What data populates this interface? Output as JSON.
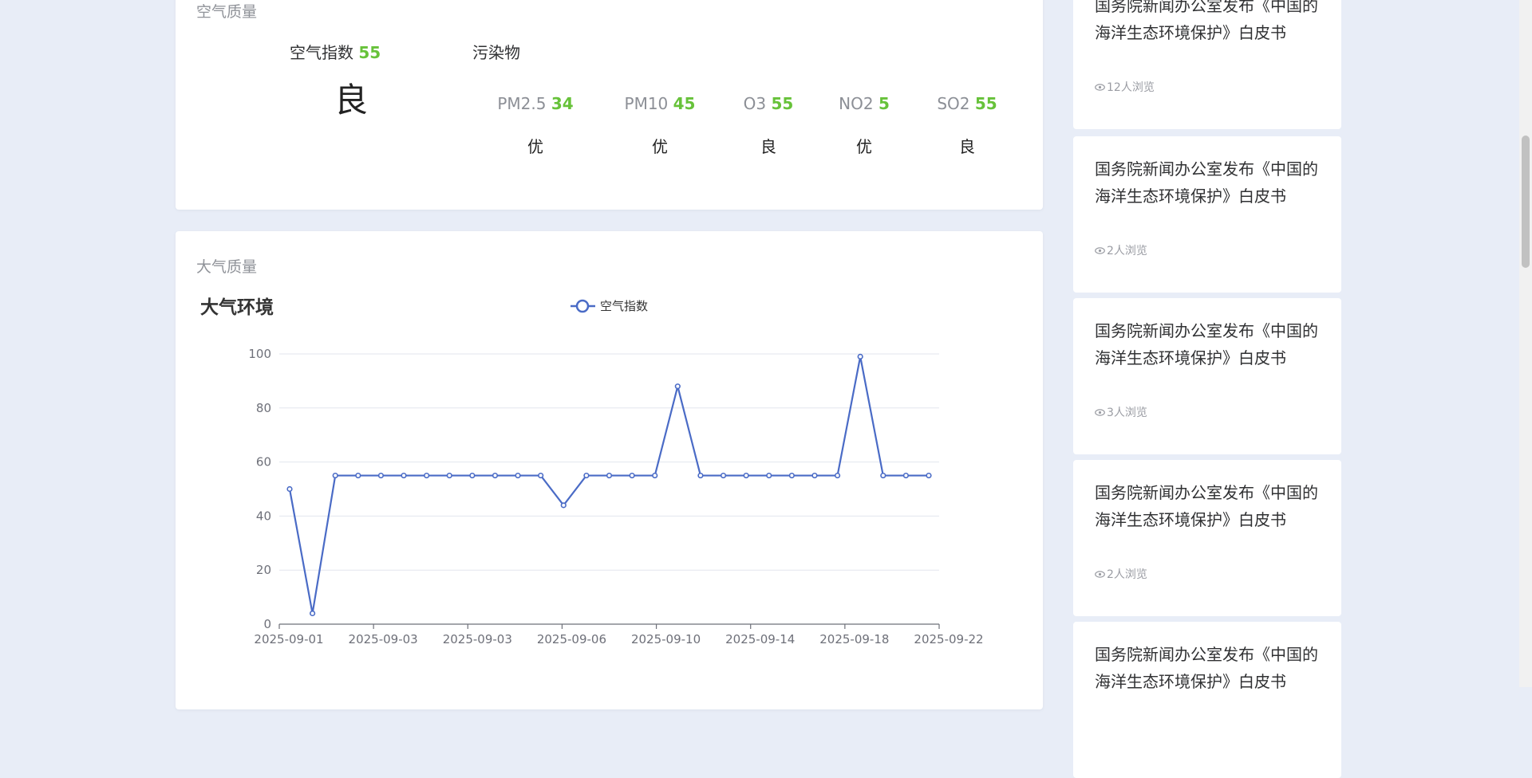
{
  "air_quality": {
    "title": "空气质量",
    "aqi_label": "空气指数",
    "aqi_value": "55",
    "aqi_level": "良",
    "pollutant_title": "污染物",
    "pollutants": [
      {
        "name": "PM2.5",
        "value": "34",
        "level": "优"
      },
      {
        "name": "PM10",
        "value": "45",
        "level": "优"
      },
      {
        "name": "O3",
        "value": "55",
        "level": "良"
      },
      {
        "name": "NO2",
        "value": "5",
        "level": "优"
      },
      {
        "name": "SO2",
        "value": "55",
        "level": "良"
      }
    ]
  },
  "atmosphere": {
    "title": "大气质量"
  },
  "chart_data": {
    "type": "line",
    "title": "大气环境",
    "series": [
      {
        "name": "空气指数",
        "color": "#4a6bc6",
        "values": [
          50,
          4,
          55,
          55,
          55,
          55,
          55,
          55,
          55,
          55,
          55,
          55,
          44,
          55,
          55,
          55,
          55,
          88,
          55,
          55,
          55,
          55,
          55,
          55,
          55,
          99,
          55,
          55,
          55
        ]
      }
    ],
    "x_tick_labels": [
      "2025-09-01",
      "2025-09-03",
      "2025-09-03",
      "2025-09-06",
      "2025-09-10",
      "2025-09-14",
      "2025-09-18",
      "2025-09-22"
    ],
    "y_ticks": [
      0,
      20,
      40,
      60,
      80,
      100
    ],
    "ylim": [
      0,
      100
    ],
    "legend_position": "top-center",
    "grid": true
  },
  "news": [
    {
      "title": "国务院新闻办公室发布《中国的海洋生态环境保护》白皮书",
      "views": "12人浏览"
    },
    {
      "title": "国务院新闻办公室发布《中国的海洋生态环境保护》白皮书",
      "views": "2人浏览"
    },
    {
      "title": "国务院新闻办公室发布《中国的海洋生态环境保护》白皮书",
      "views": "3人浏览"
    },
    {
      "title": "国务院新闻办公室发布《中国的海洋生态环境保护》白皮书",
      "views": "2人浏览"
    },
    {
      "title": "国务院新闻办公室发布《中国的海洋生态环境保护》白皮书",
      "views": ""
    }
  ]
}
